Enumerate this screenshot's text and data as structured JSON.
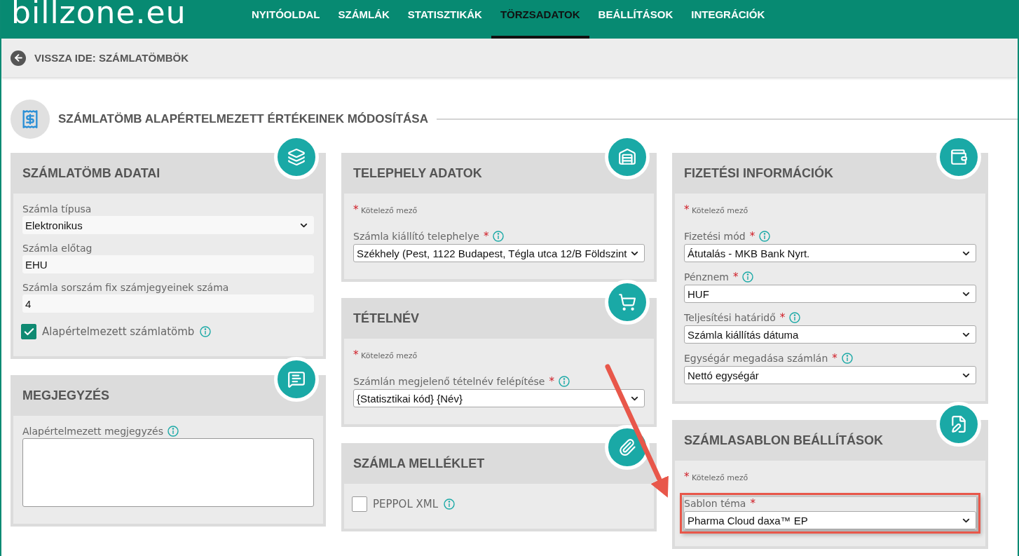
{
  "logo": "billzone.eu",
  "nav": [
    {
      "label": "NYITÓOLDAL",
      "selected": false
    },
    {
      "label": "SZÁMLÁK",
      "selected": false
    },
    {
      "label": "STATISZTIKÁK",
      "selected": false
    },
    {
      "label": "TÖRZSADATOK",
      "selected": true
    },
    {
      "label": "BEÁLLÍTÁSOK",
      "selected": false
    },
    {
      "label": "INTEGRÁCIÓK",
      "selected": false
    }
  ],
  "back_link": "VISSZA IDE: SZÁMLATÖMBÖK",
  "page_title": "SZÁMLATÖMB ALAPÉRTELMEZETT ÉRTÉKEINEK MÓDOSÍTÁSA",
  "required_mark": "*",
  "columns": [
    {
      "cards": [
        {
          "title": "SZÁMLATÖMB ADATAI",
          "fields": [
            {
              "kind": "select-flat",
              "label": "Számla típusa",
              "value": "Elektronikus"
            },
            {
              "kind": "input-flat",
              "label": "Számla előtag",
              "value": "EHU"
            },
            {
              "kind": "input-flat",
              "label": "Számla sorszám fix számjegyeinek száma",
              "value": "4"
            },
            {
              "kind": "checkbox",
              "label": "Alapértelmezett számlatömb",
              "checked": true,
              "info": true
            }
          ]
        },
        {
          "title": "MEGJEGYZÉS",
          "fields": [
            {
              "kind": "textarea",
              "label": "Alapértelmezett megjegyzés",
              "info": true
            }
          ]
        }
      ]
    },
    {
      "cards": [
        {
          "title": "TELEPHELY ADATOK",
          "required_note": "Kötelező mező",
          "fields": [
            {
              "kind": "select",
              "label": "Számla kiállító telephelye",
              "value": "Székhely (Pest, 1122 Budapest, Tégla utca 12/B Földszint",
              "required": true,
              "info": true
            }
          ]
        },
        {
          "title": "TÉTELNÉV",
          "required_note": "Kötelező mező",
          "fields": [
            {
              "kind": "select",
              "label": "Számlán megjelenő tételnév felépítése",
              "value": "{Statisztikai kód} {Név}",
              "required": true,
              "info": true
            }
          ]
        },
        {
          "title": "SZÁMLA MELLÉKLET",
          "fields": [
            {
              "kind": "checkbox",
              "label": "PEPPOL XML",
              "checked": false,
              "info": true
            }
          ]
        }
      ]
    },
    {
      "cards": [
        {
          "title": "FIZETÉSI INFORMÁCIÓK",
          "required_note": "Kötelező mező",
          "fields": [
            {
              "kind": "select",
              "label": "Fizetési mód",
              "value": "Átutalás - MKB Bank Nyrt.",
              "required": true,
              "info": true
            },
            {
              "kind": "select",
              "label": "Pénznem",
              "value": "HUF",
              "required": true,
              "info": true
            },
            {
              "kind": "select",
              "label": "Teljesítési határidő",
              "value": "Számla kiállítás dátuma",
              "required": true,
              "info": true
            },
            {
              "kind": "select",
              "label": "Egységár megadása számlán",
              "value": "Nettó egységár",
              "required": true,
              "info": true
            }
          ]
        },
        {
          "title": "SZÁMLASABLON BEÁLLÍTÁSOK",
          "required_note": "Kötelező mező",
          "fields": [
            {
              "kind": "select",
              "label": "Sablon téma",
              "value": "Pharma Cloud daxa™ EP",
              "required": true,
              "highlighted": true
            }
          ]
        }
      ]
    }
  ]
}
